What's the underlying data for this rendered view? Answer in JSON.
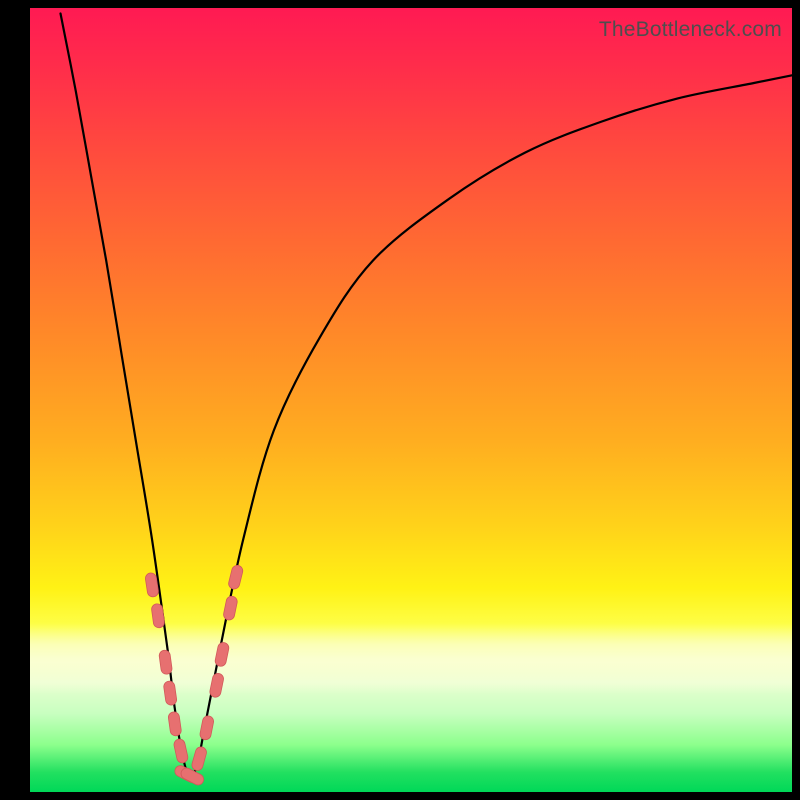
{
  "watermark": "TheBottleneck.com",
  "colors": {
    "frame": "#000000",
    "curve": "#000000",
    "blob_fill": "#e77070",
    "blob_stroke": "#d25a5a",
    "gradient_top": "#ff1a53",
    "gradient_mid": "#ffd21a",
    "gradient_bottom": "#00d858"
  },
  "chart_data": {
    "type": "line",
    "title": "",
    "xlabel": "",
    "ylabel": "",
    "xlim": [
      0,
      100
    ],
    "ylim": [
      0,
      100
    ],
    "grid": false,
    "legend": false,
    "notes": "V-shaped bottleneck curve on a red→yellow→green vertical gradient. X seems to represent a component-scale axis (unlabeled); Y increases downward toward green/optimal (lower = better match). Minimum (tip of the V) sits near x≈21 on a 0–100 span. Salmon lozenge markers hug both legs near the bottom.",
    "series": [
      {
        "name": "bottleneck-curve",
        "x": [
          4,
          6,
          8,
          10,
          12,
          14,
          16,
          18,
          19,
          20,
          21,
          22,
          23,
          25,
          28,
          32,
          38,
          45,
          55,
          65,
          75,
          85,
          95,
          100
        ],
        "y": [
          100,
          90,
          79,
          68,
          56,
          44,
          32,
          18,
          10,
          4,
          1,
          3,
          8,
          18,
          32,
          46,
          58,
          68,
          76,
          82,
          86,
          89,
          91,
          92
        ]
      }
    ],
    "markers": [
      {
        "leg": "left",
        "x": 16.0,
        "y": 26
      },
      {
        "leg": "left",
        "x": 16.8,
        "y": 22
      },
      {
        "leg": "left",
        "x": 17.8,
        "y": 16
      },
      {
        "leg": "left",
        "x": 18.4,
        "y": 12
      },
      {
        "leg": "left",
        "x": 19.0,
        "y": 8
      },
      {
        "leg": "left",
        "x": 19.8,
        "y": 4.5
      },
      {
        "leg": "tip",
        "x": 20.5,
        "y": 1.5
      },
      {
        "leg": "tip",
        "x": 21.3,
        "y": 1.2
      },
      {
        "leg": "right",
        "x": 22.2,
        "y": 3.5
      },
      {
        "leg": "right",
        "x": 23.2,
        "y": 7.5
      },
      {
        "leg": "right",
        "x": 24.5,
        "y": 13
      },
      {
        "leg": "right",
        "x": 25.2,
        "y": 17
      },
      {
        "leg": "right",
        "x": 26.3,
        "y": 23
      },
      {
        "leg": "right",
        "x": 27.0,
        "y": 27
      }
    ]
  }
}
